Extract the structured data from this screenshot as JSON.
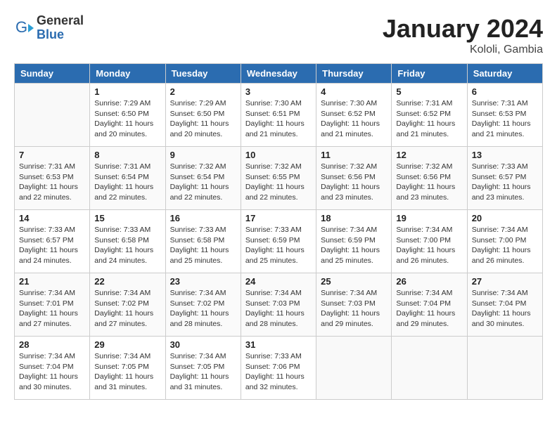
{
  "header": {
    "logo_general": "General",
    "logo_blue": "Blue",
    "month_year": "January 2024",
    "location": "Kololi, Gambia"
  },
  "weekdays": [
    "Sunday",
    "Monday",
    "Tuesday",
    "Wednesday",
    "Thursday",
    "Friday",
    "Saturday"
  ],
  "weeks": [
    [
      {
        "day": "",
        "info": ""
      },
      {
        "day": "1",
        "info": "Sunrise: 7:29 AM\nSunset: 6:50 PM\nDaylight: 11 hours\nand 20 minutes."
      },
      {
        "day": "2",
        "info": "Sunrise: 7:29 AM\nSunset: 6:50 PM\nDaylight: 11 hours\nand 20 minutes."
      },
      {
        "day": "3",
        "info": "Sunrise: 7:30 AM\nSunset: 6:51 PM\nDaylight: 11 hours\nand 21 minutes."
      },
      {
        "day": "4",
        "info": "Sunrise: 7:30 AM\nSunset: 6:52 PM\nDaylight: 11 hours\nand 21 minutes."
      },
      {
        "day": "5",
        "info": "Sunrise: 7:31 AM\nSunset: 6:52 PM\nDaylight: 11 hours\nand 21 minutes."
      },
      {
        "day": "6",
        "info": "Sunrise: 7:31 AM\nSunset: 6:53 PM\nDaylight: 11 hours\nand 21 minutes."
      }
    ],
    [
      {
        "day": "7",
        "info": "Sunrise: 7:31 AM\nSunset: 6:53 PM\nDaylight: 11 hours\nand 22 minutes."
      },
      {
        "day": "8",
        "info": "Sunrise: 7:31 AM\nSunset: 6:54 PM\nDaylight: 11 hours\nand 22 minutes."
      },
      {
        "day": "9",
        "info": "Sunrise: 7:32 AM\nSunset: 6:54 PM\nDaylight: 11 hours\nand 22 minutes."
      },
      {
        "day": "10",
        "info": "Sunrise: 7:32 AM\nSunset: 6:55 PM\nDaylight: 11 hours\nand 22 minutes."
      },
      {
        "day": "11",
        "info": "Sunrise: 7:32 AM\nSunset: 6:56 PM\nDaylight: 11 hours\nand 23 minutes."
      },
      {
        "day": "12",
        "info": "Sunrise: 7:32 AM\nSunset: 6:56 PM\nDaylight: 11 hours\nand 23 minutes."
      },
      {
        "day": "13",
        "info": "Sunrise: 7:33 AM\nSunset: 6:57 PM\nDaylight: 11 hours\nand 23 minutes."
      }
    ],
    [
      {
        "day": "14",
        "info": "Sunrise: 7:33 AM\nSunset: 6:57 PM\nDaylight: 11 hours\nand 24 minutes."
      },
      {
        "day": "15",
        "info": "Sunrise: 7:33 AM\nSunset: 6:58 PM\nDaylight: 11 hours\nand 24 minutes."
      },
      {
        "day": "16",
        "info": "Sunrise: 7:33 AM\nSunset: 6:58 PM\nDaylight: 11 hours\nand 25 minutes."
      },
      {
        "day": "17",
        "info": "Sunrise: 7:33 AM\nSunset: 6:59 PM\nDaylight: 11 hours\nand 25 minutes."
      },
      {
        "day": "18",
        "info": "Sunrise: 7:34 AM\nSunset: 6:59 PM\nDaylight: 11 hours\nand 25 minutes."
      },
      {
        "day": "19",
        "info": "Sunrise: 7:34 AM\nSunset: 7:00 PM\nDaylight: 11 hours\nand 26 minutes."
      },
      {
        "day": "20",
        "info": "Sunrise: 7:34 AM\nSunset: 7:00 PM\nDaylight: 11 hours\nand 26 minutes."
      }
    ],
    [
      {
        "day": "21",
        "info": "Sunrise: 7:34 AM\nSunset: 7:01 PM\nDaylight: 11 hours\nand 27 minutes."
      },
      {
        "day": "22",
        "info": "Sunrise: 7:34 AM\nSunset: 7:02 PM\nDaylight: 11 hours\nand 27 minutes."
      },
      {
        "day": "23",
        "info": "Sunrise: 7:34 AM\nSunset: 7:02 PM\nDaylight: 11 hours\nand 28 minutes."
      },
      {
        "day": "24",
        "info": "Sunrise: 7:34 AM\nSunset: 7:03 PM\nDaylight: 11 hours\nand 28 minutes."
      },
      {
        "day": "25",
        "info": "Sunrise: 7:34 AM\nSunset: 7:03 PM\nDaylight: 11 hours\nand 29 minutes."
      },
      {
        "day": "26",
        "info": "Sunrise: 7:34 AM\nSunset: 7:04 PM\nDaylight: 11 hours\nand 29 minutes."
      },
      {
        "day": "27",
        "info": "Sunrise: 7:34 AM\nSunset: 7:04 PM\nDaylight: 11 hours\nand 30 minutes."
      }
    ],
    [
      {
        "day": "28",
        "info": "Sunrise: 7:34 AM\nSunset: 7:04 PM\nDaylight: 11 hours\nand 30 minutes."
      },
      {
        "day": "29",
        "info": "Sunrise: 7:34 AM\nSunset: 7:05 PM\nDaylight: 11 hours\nand 31 minutes."
      },
      {
        "day": "30",
        "info": "Sunrise: 7:34 AM\nSunset: 7:05 PM\nDaylight: 11 hours\nand 31 minutes."
      },
      {
        "day": "31",
        "info": "Sunrise: 7:33 AM\nSunset: 7:06 PM\nDaylight: 11 hours\nand 32 minutes."
      },
      {
        "day": "",
        "info": ""
      },
      {
        "day": "",
        "info": ""
      },
      {
        "day": "",
        "info": ""
      }
    ]
  ]
}
